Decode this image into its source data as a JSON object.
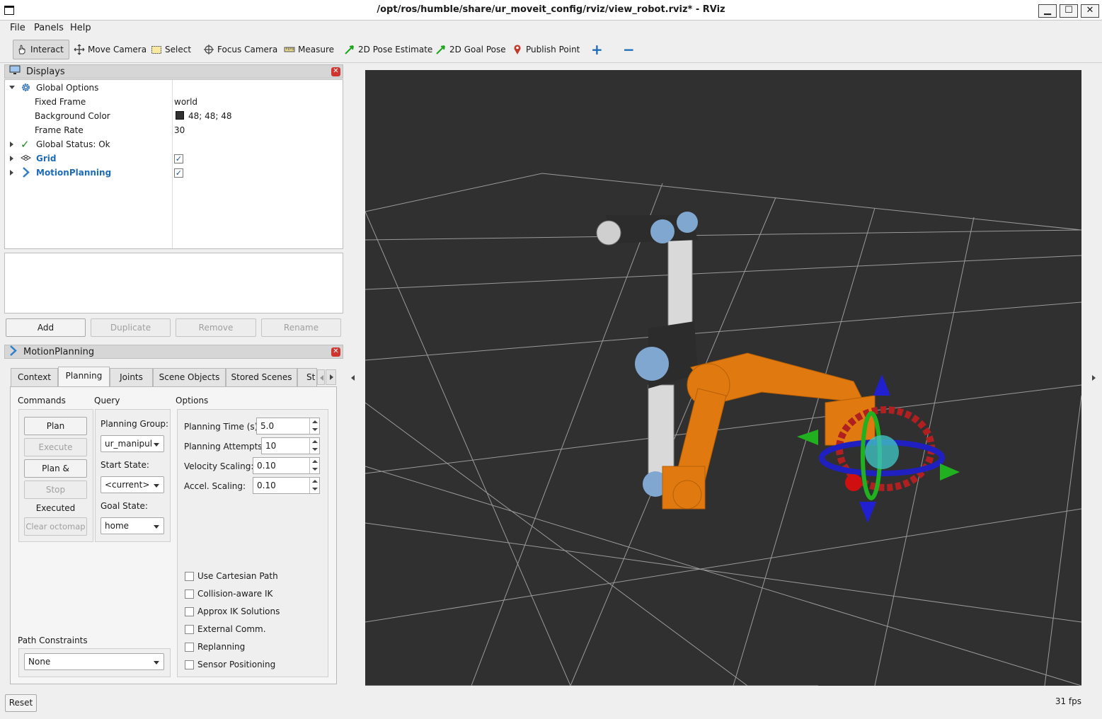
{
  "window": {
    "title": "/opt/ros/humble/share/ur_moveit_config/rviz/view_robot.rviz* - RViz",
    "minimize": "▁",
    "maximize": "☐",
    "close": "✕"
  },
  "menu": [
    "File",
    "Panels",
    "Help"
  ],
  "toolbar": {
    "interact": "Interact",
    "move_camera": "Move Camera",
    "select": "Select",
    "focus_camera": "Focus Camera",
    "measure": "Measure",
    "pose_estimate": "2D Pose Estimate",
    "goal_pose": "2D Goal Pose",
    "publish_point": "Publish Point",
    "add_tool": "+",
    "remove_tool": "−"
  },
  "displays": {
    "title": "Displays",
    "global_options": "Global Options",
    "fixed_frame": {
      "label": "Fixed Frame",
      "value": "world"
    },
    "background_color": {
      "label": "Background Color",
      "value": "48; 48; 48",
      "swatch": "#303030"
    },
    "frame_rate": {
      "label": "Frame Rate",
      "value": "30"
    },
    "global_status": "Global Status: Ok",
    "grid": "Grid",
    "motion_planning": "MotionPlanning",
    "buttons": {
      "add": "Add",
      "duplicate": "Duplicate",
      "remove": "Remove",
      "rename": "Rename"
    }
  },
  "motion_panel": {
    "title": "MotionPlanning",
    "tabs": [
      "Context",
      "Planning",
      "Joints",
      "Scene Objects",
      "Stored Scenes",
      "St"
    ],
    "commands": {
      "heading": "Commands",
      "plan": "Plan",
      "execute": "Execute",
      "plan_execute": "Plan & Execute",
      "stop": "Stop",
      "status": "Executed",
      "clear_octomap": "Clear octomap"
    },
    "query": {
      "heading": "Query",
      "planning_group_label": "Planning Group:",
      "planning_group": "ur_manipul",
      "start_state_label": "Start State:",
      "start_state": "<current>",
      "goal_state_label": "Goal State:",
      "goal_state": "home"
    },
    "options": {
      "heading": "Options",
      "planning_time_label": "Planning Time (s):",
      "planning_time": "5.0",
      "planning_attempts_label": "Planning Attempts:",
      "planning_attempts": "10",
      "velocity_label": "Velocity Scaling:",
      "velocity": "0.10",
      "accel_label": "Accel. Scaling:",
      "accel": "0.10",
      "checkboxes": [
        "Use Cartesian Path",
        "Collision-aware IK",
        "Approx IK Solutions",
        "External Comm.",
        "Replanning",
        "Sensor Positioning"
      ]
    },
    "path_constraints": {
      "heading": "Path Constraints",
      "value": "None"
    }
  },
  "bottom": {
    "reset": "Reset",
    "fps": "31 fps"
  },
  "colors": {
    "viewport_bg": "#303030",
    "grid": "#9a9a9a",
    "goal_robot": "#e07a10",
    "accent": "#1e6cb8"
  }
}
